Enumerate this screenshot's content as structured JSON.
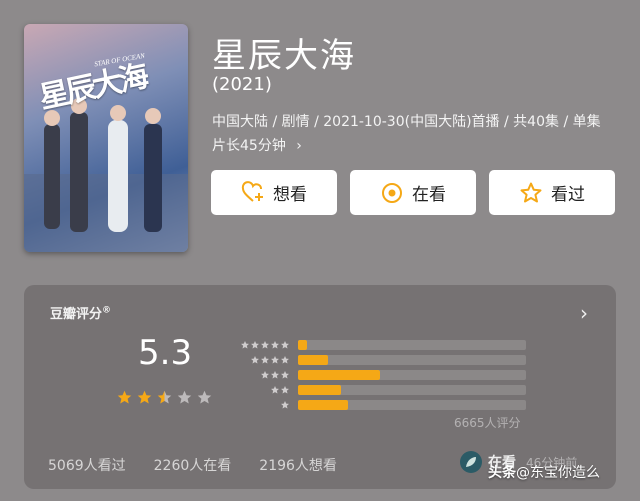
{
  "poster": {
    "title_art": "星辰大海",
    "subtitle_art": "STAR OF OCEAN"
  },
  "title": "星辰大海",
  "year": "(2021)",
  "meta": {
    "region": "中国大陆",
    "genre": "剧情",
    "premiere": "2021-10-30(中国大陆)首播",
    "episodes": "共40集",
    "duration": "单集片长45分钟",
    "separator": "/",
    "more": "›"
  },
  "actions": {
    "want": "想看",
    "doing": "在看",
    "done": "看过",
    "want_icon": "heart-plus-icon",
    "doing_icon": "circle-dot-icon",
    "done_icon": "star-outline-icon",
    "accent": "#f5a816"
  },
  "rating": {
    "label": "豆瓣评分",
    "reg": "®",
    "score": "5.3",
    "stars_value": 2.5,
    "distribution": [
      {
        "stars": 5,
        "percent": 4
      },
      {
        "stars": 4,
        "percent": 13
      },
      {
        "stars": 3,
        "percent": 36
      },
      {
        "stars": 2,
        "percent": 19
      },
      {
        "stars": 1,
        "percent": 22
      }
    ],
    "count": "6665人评分",
    "more": "›"
  },
  "stats": {
    "watched": "5069人看过",
    "watching": "2260人在看",
    "want": "2196人想看"
  },
  "status": {
    "label": "在看",
    "duration": "46分钟前"
  },
  "watermark": {
    "brand": "头条",
    "handle": "@东宝你造么"
  }
}
